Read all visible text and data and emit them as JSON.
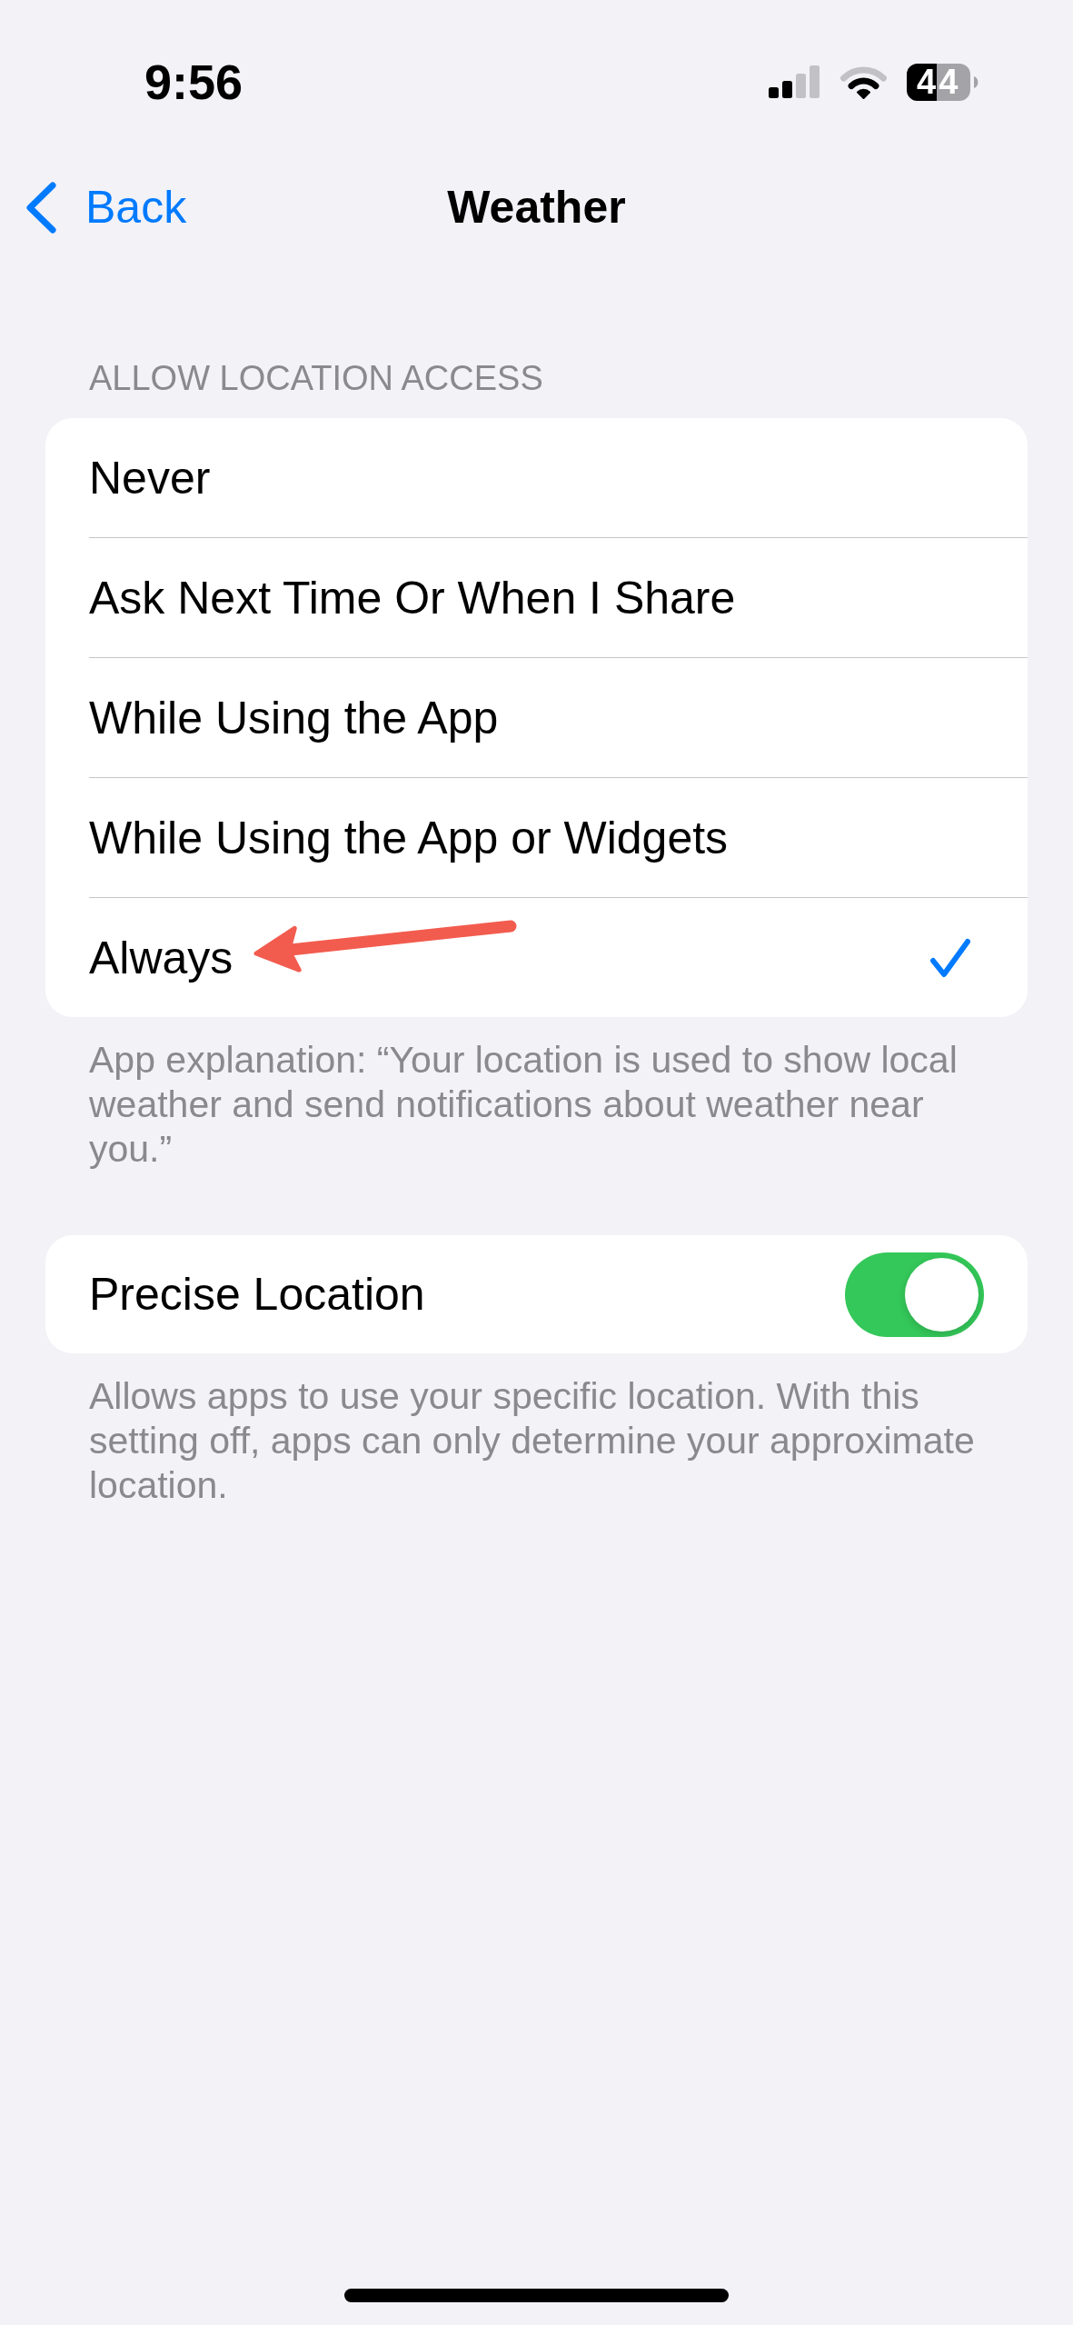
{
  "status_bar": {
    "time": "9:56",
    "battery": "44"
  },
  "nav": {
    "back": "Back",
    "title": "Weather"
  },
  "location_access": {
    "header": "ALLOW LOCATION ACCESS",
    "options": [
      {
        "label": "Never",
        "selected": false,
        "arrow": false
      },
      {
        "label": "Ask Next Time Or When I Share",
        "selected": false,
        "arrow": false
      },
      {
        "label": "While Using the App",
        "selected": false,
        "arrow": false
      },
      {
        "label": "While Using the App or Widgets",
        "selected": false,
        "arrow": false
      },
      {
        "label": "Always",
        "selected": true,
        "arrow": true
      }
    ],
    "footer": "App explanation: “Your location is used to show local weather and send notifications about weather near you.”"
  },
  "precise_location": {
    "label": "Precise Location",
    "on": true,
    "footer": "Allows apps to use your specific location. With this setting off, apps can only determine your approximate location."
  }
}
